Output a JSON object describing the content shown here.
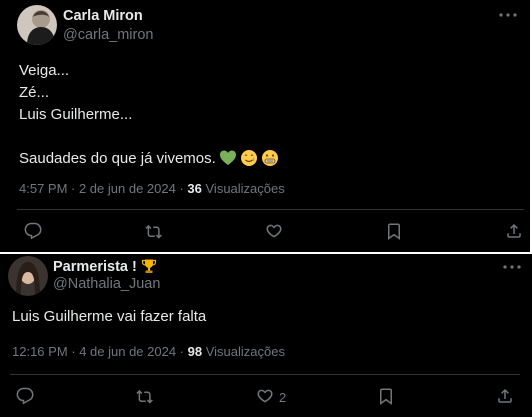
{
  "colors": {
    "background": "#000000",
    "text_primary": "#e7e9ea",
    "text_secondary": "#71767b",
    "divider": "#2f3336",
    "heart_emoji": "#78b159"
  },
  "tweets": [
    {
      "author_name": "Carla Miron",
      "author_handle": "@carla_miron",
      "verified_icon": null,
      "body_lines": [
        "Veiga...",
        "Zé...",
        "Luis Guilherme...",
        "",
        "Saudades do que já vivemos."
      ],
      "emojis": [
        "green-heart-icon",
        "smiling-face-with-tear-icon",
        "grimacing-face-icon"
      ],
      "timestamp": "4:57 PM · 2 de jun de 2024 ·",
      "views_count": "36",
      "views_label": "Visualizações",
      "actions": {
        "reply_count": "",
        "retweet_count": "",
        "like_count": "",
        "bookmark_count": ""
      }
    },
    {
      "author_name": "Parmerista !",
      "author_badge_icon": "trophy-icon",
      "author_handle": "@Nathalia_Juan",
      "body_lines": [
        "Luis Guilherme vai fazer falta"
      ],
      "timestamp": "12:16 PM · 4 de jun de 2024 ·",
      "views_count": "98",
      "views_label": "Visualizações",
      "actions": {
        "reply_count": "",
        "retweet_count": "",
        "like_count": "2",
        "bookmark_count": ""
      }
    }
  ]
}
